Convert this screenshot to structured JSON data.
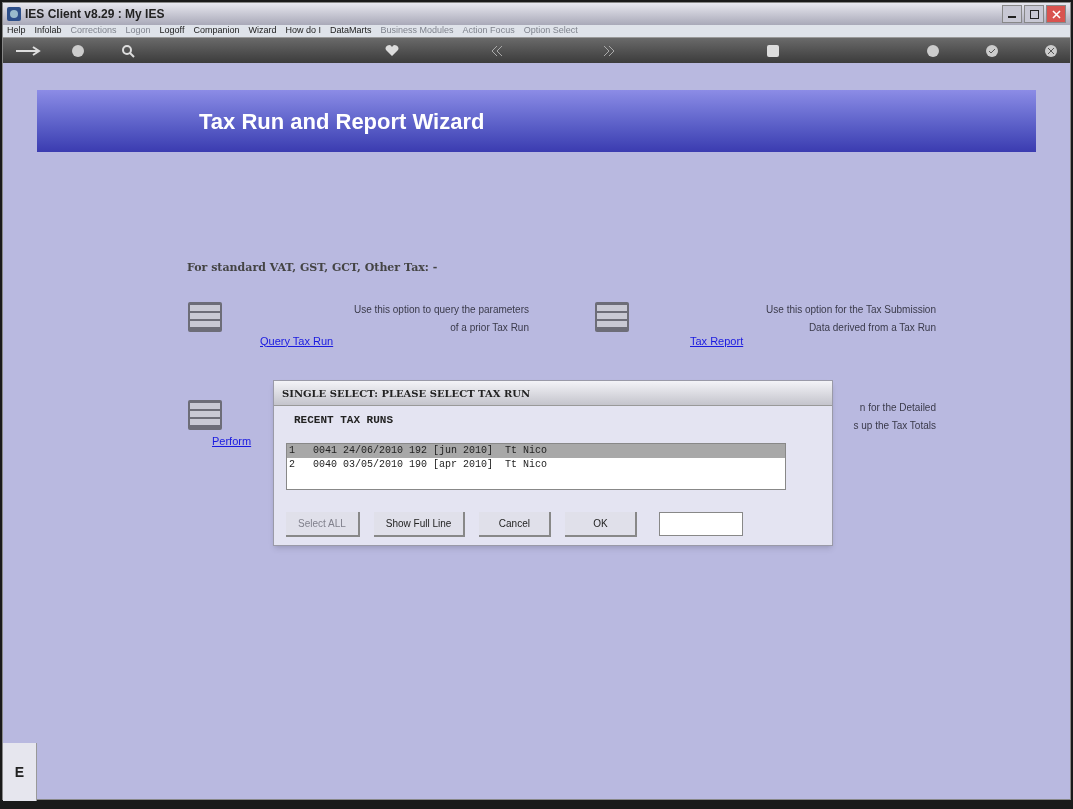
{
  "window": {
    "title": "IES Client v8.29 : My IES"
  },
  "menu": [
    {
      "label": "Help",
      "disabled": false
    },
    {
      "label": "Infolab",
      "disabled": false
    },
    {
      "label": "Corrections",
      "disabled": true
    },
    {
      "label": "Logon",
      "disabled": true
    },
    {
      "label": "Logoff",
      "disabled": false
    },
    {
      "label": "Companion",
      "disabled": false
    },
    {
      "label": "Wizard",
      "disabled": false
    },
    {
      "label": "How do I",
      "disabled": false
    },
    {
      "label": "DataMarts",
      "disabled": false
    },
    {
      "label": "Business Modules",
      "disabled": true
    },
    {
      "label": "Action Focus",
      "disabled": true
    },
    {
      "label": "Option Select",
      "disabled": true
    }
  ],
  "header": {
    "title": "Tax Run and Report Wizard"
  },
  "subtitle": "For standard VAT, GST, GCT, Other Tax: -",
  "options": [
    {
      "description": [
        "Use this option to query the parameters",
        "of a prior Tax Run"
      ],
      "link": "Query Tax Run"
    },
    {
      "description": [
        "Use this option for the Tax Submission",
        "Data derived from a Tax Run"
      ],
      "link": "Tax Report"
    },
    {
      "link": "Perform"
    },
    {
      "description": [
        "n for the Detailed",
        "s up the Tax Totals"
      ]
    }
  ],
  "dialog": {
    "title": "SINGLE SELECT: PLEASE SELECT TAX RUN",
    "heading": "RECENT TAX RUNS",
    "rows": [
      {
        "index": "1",
        "text": "0041 24/06/2010 192 [jun 2010]  Tt Nico",
        "selected": true
      },
      {
        "index": "2",
        "text": "0040 03/05/2010 190 [apr 2010]  Tt Nico",
        "selected": false
      }
    ],
    "buttons": [
      {
        "label": "Select ALL",
        "disabled": true
      },
      {
        "label": "Show Full Line",
        "disabled": false
      },
      {
        "label": "Cancel",
        "disabled": false
      },
      {
        "label": "OK",
        "disabled": false
      }
    ]
  },
  "side_tab": {
    "label": "E"
  }
}
